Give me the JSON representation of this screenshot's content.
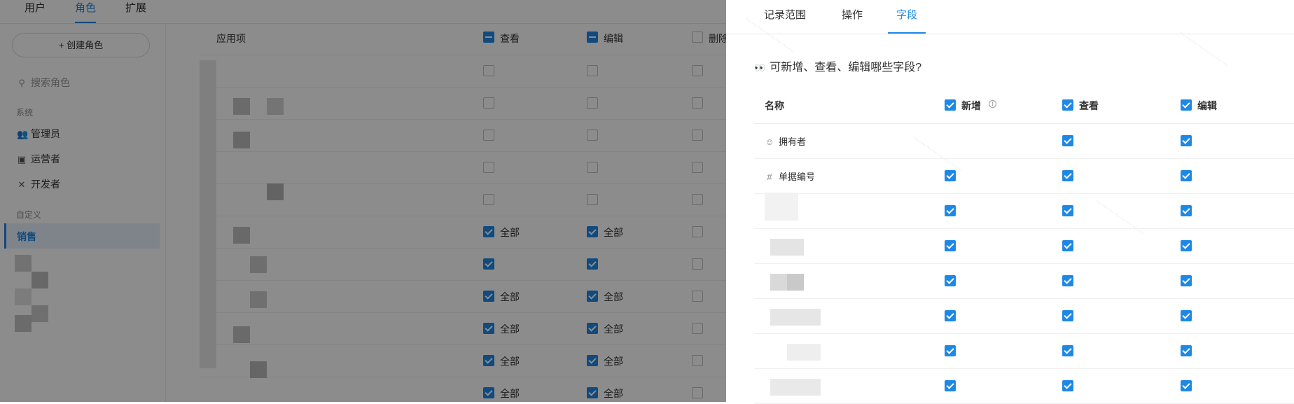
{
  "topnav": {
    "tabs": [
      {
        "label": "用户"
      },
      {
        "label": "角色",
        "active": true
      },
      {
        "label": "扩展"
      }
    ]
  },
  "sidebar": {
    "create_label": "+ 创建角色",
    "search_placeholder": "搜索角色",
    "sections": [
      {
        "label": "系统",
        "items": [
          {
            "label": "管理员",
            "icon": "users-icon"
          },
          {
            "label": "运营者",
            "icon": "id-card-icon"
          },
          {
            "label": "开发者",
            "icon": "tools-icon"
          }
        ]
      },
      {
        "label": "自定义",
        "items": [
          {
            "label": "销售",
            "active": true
          }
        ]
      }
    ]
  },
  "main": {
    "columns": [
      "应用项",
      "查看",
      "编辑",
      "删除"
    ],
    "rows": [
      {
        "view": false,
        "edit": false
      },
      {
        "view": false,
        "edit": false
      },
      {
        "view": false,
        "edit": false
      },
      {
        "view": false,
        "edit": false
      },
      {
        "view": false,
        "edit": false
      },
      {
        "view": true,
        "view_label": "全部",
        "edit": true,
        "edit_label": "全部"
      },
      {
        "view": true,
        "view_label": "",
        "edit": true,
        "edit_label": ""
      },
      {
        "view": true,
        "view_label": "全部",
        "edit": true,
        "edit_label": "全部"
      },
      {
        "view": true,
        "view_label": "全部",
        "edit": true,
        "edit_label": "全部"
      },
      {
        "view": true,
        "view_label": "全部",
        "edit": true,
        "edit_label": "全部"
      },
      {
        "view": true,
        "view_label": "全部",
        "edit": true,
        "edit_label": "全部"
      }
    ]
  },
  "drawer": {
    "tabs": [
      {
        "label": "记录范围"
      },
      {
        "label": "操作"
      },
      {
        "label": "字段",
        "active": true
      }
    ],
    "question": "可新增、查看、编辑哪些字段?",
    "columns": {
      "name": "名称",
      "add": "新增",
      "view": "查看",
      "edit": "编辑"
    },
    "fields": [
      {
        "name": "拥有者",
        "icon": "user-circle-icon",
        "add": null,
        "view": true,
        "edit": true
      },
      {
        "name": "单据编号",
        "icon": "hash-icon",
        "add": true,
        "view": true,
        "edit": true
      },
      {
        "name": "",
        "add": true,
        "view": true,
        "edit": true
      },
      {
        "name": "",
        "add": true,
        "view": true,
        "edit": true
      },
      {
        "name": "",
        "add": true,
        "view": true,
        "edit": true
      },
      {
        "name": "",
        "add": true,
        "view": true,
        "edit": true
      },
      {
        "name": "",
        "add": true,
        "view": true,
        "edit": true
      },
      {
        "name": "",
        "add": true,
        "view": true,
        "edit": true
      }
    ]
  },
  "colors": {
    "accent": "#1e88e5",
    "overlay": "rgba(0,0,0,0.45)"
  }
}
